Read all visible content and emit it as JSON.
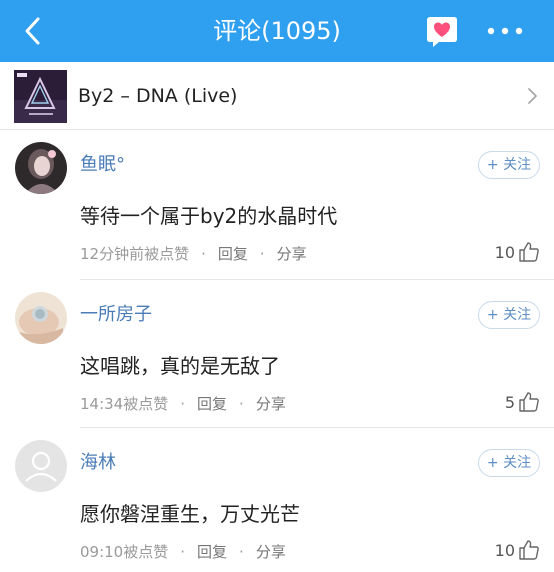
{
  "header": {
    "title": "评论(1095)",
    "accent_color": "#2f9ff0"
  },
  "song": {
    "title": "By2 – DNA (Live)"
  },
  "comments": [
    {
      "user": "鱼眠°",
      "follow_label": "+ 关注",
      "text": "等待一个属于by2的水晶时代",
      "time": "12分钟前被点赞",
      "reply_label": "回复",
      "share_label": "分享",
      "likes": "10"
    },
    {
      "user": "一所房子",
      "follow_label": "+ 关注",
      "text": "这唱跳，真的是无敌了",
      "time": "14:34被点赞",
      "reply_label": "回复",
      "share_label": "分享",
      "likes": "5"
    },
    {
      "user": "海林",
      "follow_label": "+ 关注",
      "text": "愿你磐涅重生，万丈光芒",
      "time": "09:10被点赞",
      "reply_label": "回复",
      "share_label": "分享",
      "likes": "10"
    }
  ]
}
